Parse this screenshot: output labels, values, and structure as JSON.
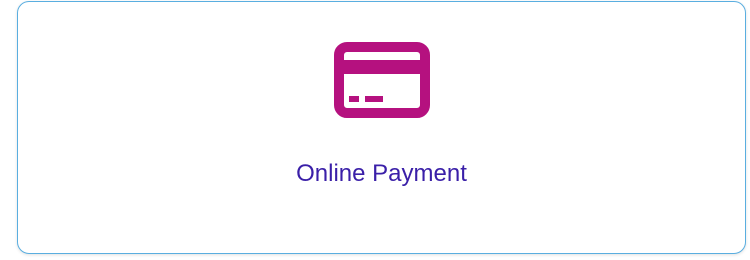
{
  "payment_option": {
    "label": "Online Payment",
    "icon": "credit-card-icon",
    "icon_color": "#b5117f",
    "label_color": "#3a1fa8",
    "border_color": "#5aaee0"
  }
}
